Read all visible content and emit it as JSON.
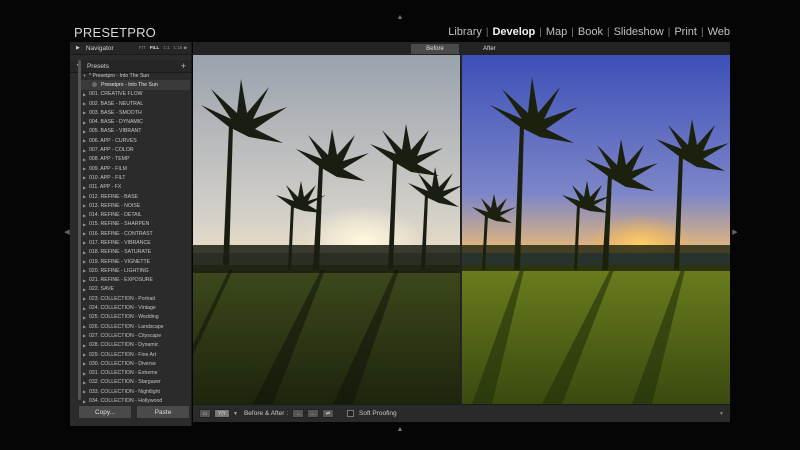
{
  "brand": "PRESETPRO",
  "modules": [
    {
      "label": "Library",
      "active": false
    },
    {
      "label": "Develop",
      "active": true
    },
    {
      "label": "Map",
      "active": false
    },
    {
      "label": "Book",
      "active": false
    },
    {
      "label": "Slideshow",
      "active": false
    },
    {
      "label": "Print",
      "active": false
    },
    {
      "label": "Web",
      "active": false
    }
  ],
  "navigator": {
    "title": "Navigator",
    "zoom": [
      "FIT",
      "FILL",
      "1:1",
      "1:16 ◆"
    ]
  },
  "presets": {
    "title": "Presets",
    "open_folder": "* Presetpro - Into The Sun",
    "selected_preset": "Presetpro - Into The Sun",
    "folders": [
      "001. CREATIVE FLOW",
      "002. BASE - NEUTRAL",
      "003. BASE - SMOOTH",
      "004. BASE - DYNAMIC",
      "005. BASE - VIBRANT",
      "006. APP - CURVES",
      "007. APP - COLOR",
      "008. APP - TEMP",
      "009. APP - FILM",
      "010. APP - FILT",
      "011. APP - FX",
      "012. REFINE - BASE",
      "013. REFINE - NOISE",
      "014. REFINE - DETAIL",
      "015. REFINE - SHARPEN",
      "016. REFINE - CONTRAST",
      "017. REFINE - VIBRANCE",
      "018. REFINE - SATURATE",
      "019. REFINE - VIGNETTE",
      "020. REFINE - LIGHTING",
      "021. REFINE - EXPOSURE",
      "022. SAVE",
      "023. COLLECTION - Portrait",
      "024. COLLECTION - Vintage",
      "025. COLLECTION - Wedding",
      "026. COLLECTION - Landscape",
      "027. COLLECTION - Cityscape",
      "028. COLLECTION - Dynamic",
      "029. COLLECTION - Fine Art",
      "030. COLLECTION - Diverse",
      "031. COLLECTION - Extreme",
      "032. COLLECTION - Stargazer",
      "033. COLLECTION - Nightlight",
      "034. COLLECTION - Hollywood"
    ]
  },
  "buttons": {
    "copy": "Copy...",
    "paste": "Paste"
  },
  "view": {
    "before_label": "Before",
    "after_label": "After"
  },
  "toolbar": {
    "view_mode": "Y|Y",
    "before_after_label": "Before & After :",
    "soft_proofing": "Soft Proofing"
  },
  "colors": {
    "accent_text": "#f2f2f2",
    "panel_bg": "#2b2b2b",
    "before_sky": "#c9c6c0",
    "after_sky": "#4a5fc2",
    "sun": "#ffd36a"
  }
}
